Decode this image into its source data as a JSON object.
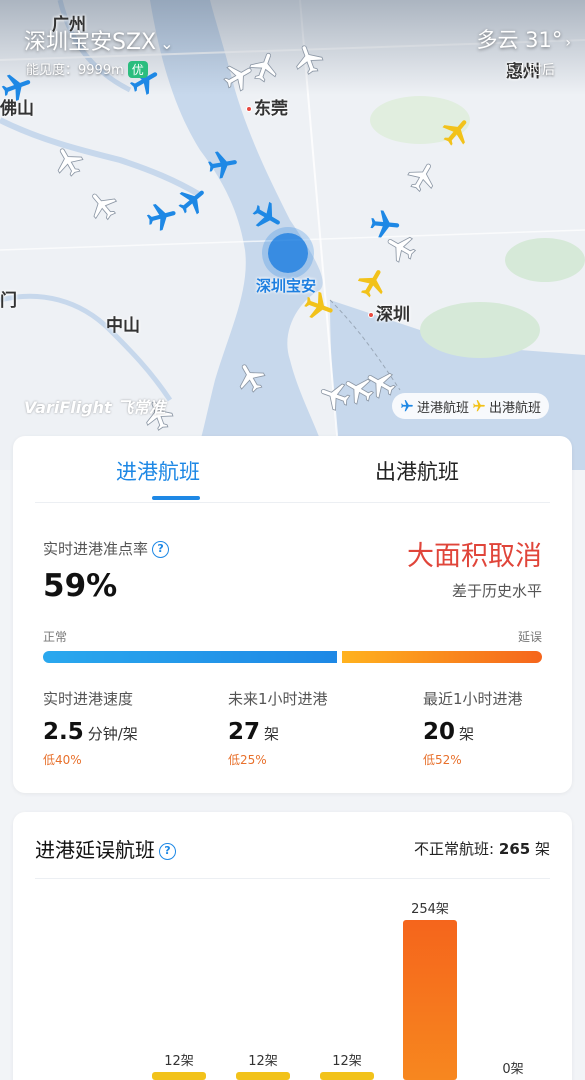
{
  "header": {
    "airport_title": "深圳宝安SZX",
    "visibility_label": "能见度：9999m",
    "visibility_badge": "优",
    "weather": "多云 31°",
    "weather_sub": "5小时后"
  },
  "map": {
    "cities": [
      "广州",
      "佛山",
      "东莞",
      "中山",
      "深圳",
      "惠州",
      "门"
    ],
    "airport_label": "深圳宝安",
    "watermark": "VariFlight 飞常准",
    "legend": {
      "arrival": "进港航班",
      "departure": "出港航班"
    },
    "colors": {
      "arrival": "#1e88e5",
      "departure": "#f2c21a",
      "other": "#ffffff"
    }
  },
  "tabs": [
    {
      "label": "进港航班",
      "active": true
    },
    {
      "label": "出港航班",
      "active": false
    }
  ],
  "ontime": {
    "label": "实时进港准点率",
    "value": "59%",
    "status": "大面积取消",
    "status_sub": "差于历史水平",
    "normal_label": "正常",
    "delay_label": "延误",
    "normal_fraction": 0.59
  },
  "stats": [
    {
      "label": "实时进港速度",
      "value": "2.5",
      "unit": "分钟/架",
      "delta": "低40%"
    },
    {
      "label": "未来1小时进港",
      "value": "27",
      "unit": "架",
      "delta": "低25%"
    },
    {
      "label": "最近1小时进港",
      "value": "20",
      "unit": "架",
      "delta": "低52%"
    }
  ],
  "delay_section": {
    "title": "进港延误航班",
    "abnormal_label": "不正常航班:",
    "abnormal_value": "265",
    "abnormal_unit": "架"
  },
  "chart_data": {
    "type": "bar",
    "categories": [
      "",
      "",
      "",
      "",
      ""
    ],
    "values": [
      12,
      12,
      12,
      254,
      0
    ],
    "labels": [
      "12架",
      "12架",
      "12架",
      "254架",
      "0架"
    ],
    "highlight_index": 3,
    "colors": {
      "normal": "#f2c21a",
      "highlight": "#f5651c"
    }
  }
}
